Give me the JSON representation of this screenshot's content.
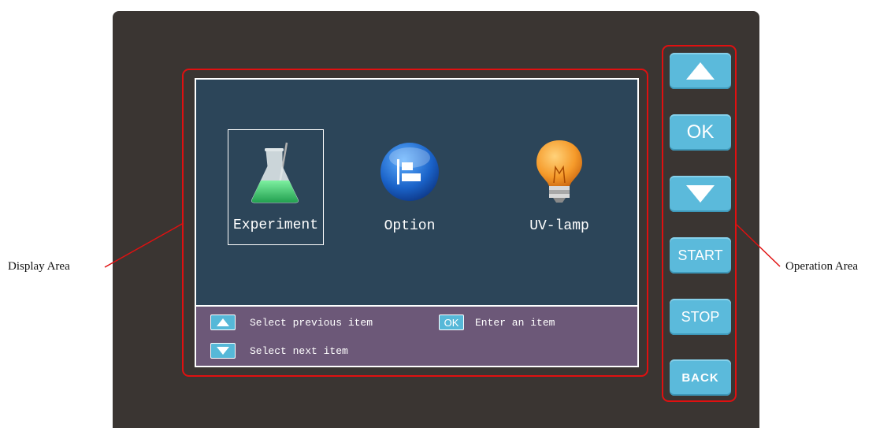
{
  "callouts": {
    "display_area": "Display Area",
    "operation_area": "Operation Area"
  },
  "menu": {
    "items": [
      {
        "label": "Experiment",
        "icon": "flask-icon",
        "selected": true
      },
      {
        "label": "Option",
        "icon": "option-icon",
        "selected": false
      },
      {
        "label": "UV-lamp",
        "icon": "lightbulb-icon",
        "selected": false
      }
    ]
  },
  "hints": {
    "previous": "Select previous item",
    "enter": "Enter an item",
    "next": "Select next item",
    "ok_key": "OK"
  },
  "keys": {
    "up": "up-arrow-icon",
    "ok": "OK",
    "down": "down-arrow-icon",
    "start": "START",
    "stop": "STOP",
    "back": "BACK"
  },
  "colors": {
    "device": "#3a3532",
    "screen": "#2c4559",
    "hint_bar": "#6c5878",
    "key": "#5bbadb",
    "outline": "#e01010"
  }
}
